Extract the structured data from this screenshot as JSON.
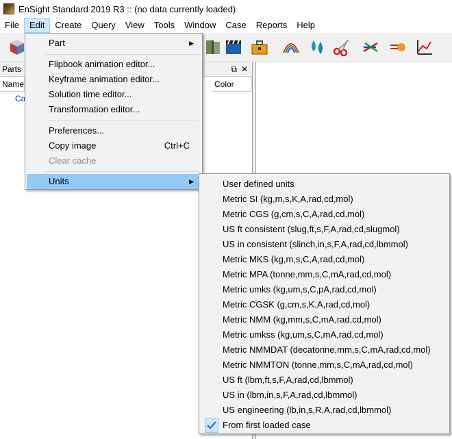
{
  "window": {
    "title": "EnSight Standard 2019 R3 ::  (no data currently loaded)"
  },
  "menubar": [
    "File",
    "Edit",
    "Create",
    "Query",
    "View",
    "Tools",
    "Window",
    "Case",
    "Reports",
    "Help"
  ],
  "parts_panel": {
    "title": "Parts",
    "columns": {
      "name": "Name",
      "color": "Color"
    },
    "tree_item": "Ca"
  },
  "edit_menu": {
    "part": "Part",
    "flipbook": "Flipbook animation editor...",
    "keyframe": "Keyframe animation editor...",
    "solution_time": "Solution time editor...",
    "transformation": "Transformation editor...",
    "preferences": "Preferences...",
    "copy_image": "Copy image",
    "copy_image_shortcut": "Ctrl+C",
    "clear_cache": "Clear cache",
    "units": "Units"
  },
  "units_menu": [
    "User defined units",
    "Metric SI (kg,m,s,K,A,rad,cd,mol)",
    "Metric CGS (g,cm,s,C,A,rad,cd,mol)",
    "US ft consistent (slug,ft,s,F,A,rad,cd,slugmol)",
    "US in consistent (slinch,in,s,F,A,rad,cd,lbmmol)",
    "Metric MKS (kg,m,s,C,A,rad,cd,mol)",
    "Metric MPA (tonne,mm,s,C,mA,rad,cd,mol)",
    "Metric umks (kg,um,s,C,pA,rad,cd,mol)",
    "Metric CGSK (g,cm,s,K,A,rad,cd,mol)",
    "Metric NMM (kg,mm,s,C,mA,rad,cd,mol)",
    "Metric umkss (kg,um,s,C,mA,rad,cd,mol)",
    "Metric NMMDAT (decatonne,mm,s,C,mA,rad,cd,mol)",
    "Metric NMMTON (tonne,mm,s,C,mA,rad,cd,mol)",
    "US ft (lbm,ft,s,F,A,rad,cd,lbmmol)",
    "US in (lbm,in,s,F,A,rad,cd,lbmmol)",
    "US engineering (lb,in,s,R,A,rad,cd,lbmmol)",
    "From first loaded case"
  ],
  "colors": {
    "menu_highlight": "#91c9f7",
    "menu_bg": "#f2f2f2",
    "tree_link": "#0033aa"
  }
}
